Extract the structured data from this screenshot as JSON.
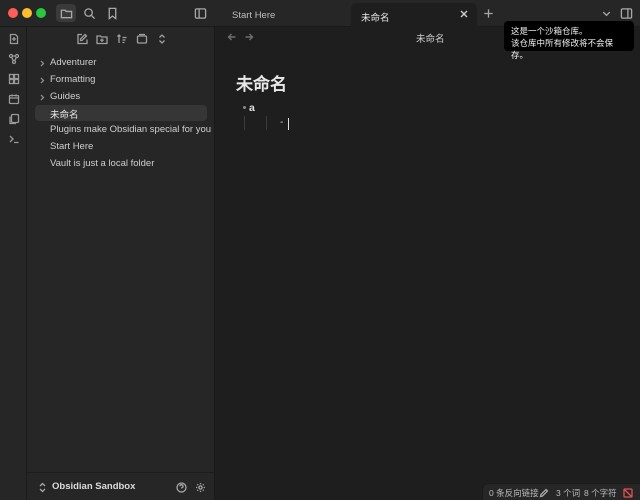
{
  "tabs": [
    {
      "label": "Start Here"
    },
    {
      "label": "未命名"
    }
  ],
  "sidebar": {
    "items": [
      {
        "label": "Adventurer",
        "folder": true
      },
      {
        "label": "Formatting",
        "folder": true
      },
      {
        "label": "Guides",
        "folder": true
      },
      {
        "label": "未命名",
        "selected": true
      },
      {
        "label": "Plugins make Obsidian special for you"
      },
      {
        "label": "Start Here"
      },
      {
        "label": "Vault is just a local folder"
      }
    ],
    "vault_name": "Obsidian Sandbox"
  },
  "editor": {
    "view_title": "未命名",
    "note_title": "未命名",
    "list_item": "a",
    "sub_line": "-"
  },
  "notice": {
    "line1": "这是一个沙箱仓库。",
    "line2": "该仓库中所有修改将不会保存。"
  },
  "status": {
    "backlinks": "0 条反向链接",
    "words": "3 个词",
    "chars": "8 个字符"
  },
  "colors": {
    "accent_red": "#e05252",
    "background": "#1e1e1e",
    "panel": "#262626"
  }
}
